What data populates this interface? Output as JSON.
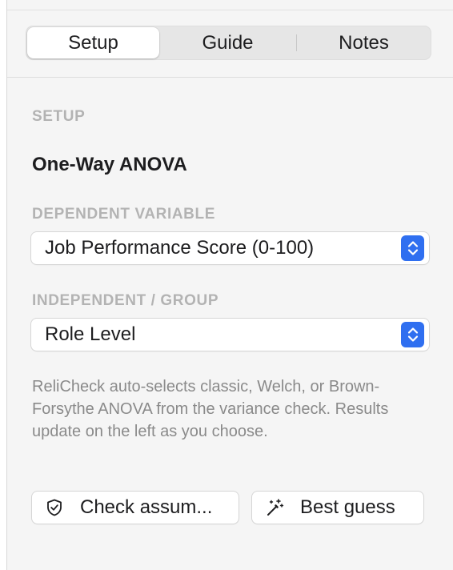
{
  "tabs": [
    {
      "label": "Setup",
      "active": true
    },
    {
      "label": "Guide",
      "active": false
    },
    {
      "label": "Notes",
      "active": false
    }
  ],
  "setup": {
    "section_label": "SETUP",
    "test_title": "One-Way ANOVA"
  },
  "dependent": {
    "label": "DEPENDENT VARIABLE",
    "selected": "Job Performance Score (0-100)"
  },
  "independent": {
    "label": "INDEPENDENT / GROUP",
    "selected": "Role Level"
  },
  "help_text": "ReliCheck auto-selects classic, Welch, or Brown-Forsythe ANOVA from the variance check. Results update on the left as you choose.",
  "actions": {
    "check_assumptions_label": "Check assum...",
    "best_guess_label": "Best guess"
  },
  "icons": {
    "check_assumptions": "shield-check-icon",
    "best_guess": "magic-wand-icon",
    "popup": "chevron-up-down-icon"
  },
  "colors": {
    "accent": "#2f6ff0",
    "section_label": "#b3b3b3",
    "help_text": "#8a8a8a"
  }
}
